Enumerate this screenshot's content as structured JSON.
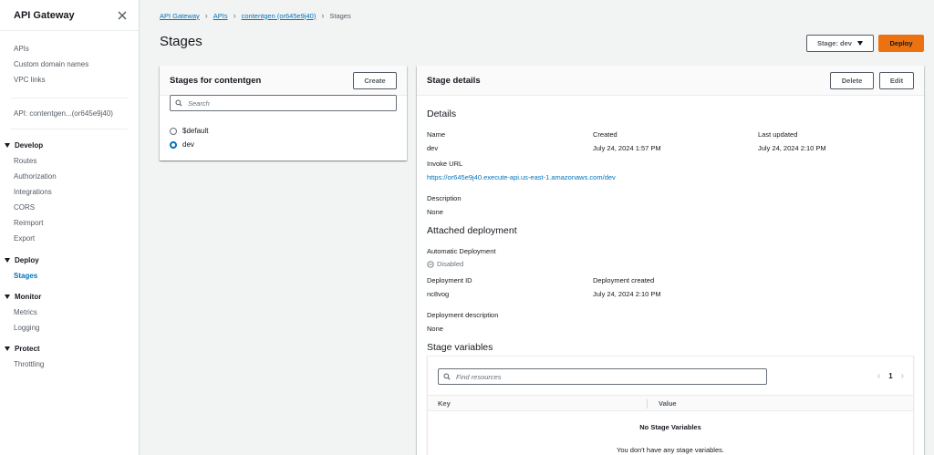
{
  "sidebar": {
    "title": "API Gateway",
    "links_top": [
      "APIs",
      "Custom domain names",
      "VPC links"
    ],
    "api_link": "API: contentgen...(or645e9j40)",
    "sections": {
      "develop": {
        "label": "Develop",
        "items": [
          "Routes",
          "Authorization",
          "Integrations",
          "CORS",
          "Reimport",
          "Export"
        ]
      },
      "deploy": {
        "label": "Deploy",
        "items": [
          "Stages"
        ]
      },
      "monitor": {
        "label": "Monitor",
        "items": [
          "Metrics",
          "Logging"
        ]
      },
      "protect": {
        "label": "Protect",
        "items": [
          "Throttling"
        ]
      }
    }
  },
  "breadcrumb": {
    "items": [
      "API Gateway",
      "APIs",
      "contentgen (or645e9j40)"
    ],
    "current": "Stages"
  },
  "page": {
    "title": "Stages"
  },
  "header_actions": {
    "stage_select": "Stage: dev",
    "deploy": "Deploy"
  },
  "stages_panel": {
    "title": "Stages for contentgen",
    "create": "Create",
    "search_placeholder": "Search",
    "stages": [
      "$default",
      "dev"
    ],
    "selected": "dev"
  },
  "details": {
    "title": "Stage details",
    "delete": "Delete",
    "edit": "Edit",
    "details_heading": "Details",
    "name_label": "Name",
    "name_value": "dev",
    "created_label": "Created",
    "created_value": "July 24, 2024 1:57 PM",
    "updated_label": "Last updated",
    "updated_value": "July 24, 2024 2:10 PM",
    "invoke_label": "Invoke URL",
    "invoke_value": "https://or645e9j40.execute-api.us-east-1.amazonaws.com/dev",
    "description_label": "Description",
    "description_value": "None",
    "attached_heading": "Attached deployment",
    "auto_label": "Automatic Deployment",
    "auto_value": "Disabled",
    "deployment_id_label": "Deployment ID",
    "deployment_id_value": "nc8vog",
    "deployment_created_label": "Deployment created",
    "deployment_created_value": "July 24, 2024 2:10 PM",
    "deployment_desc_label": "Deployment description",
    "deployment_desc_value": "None",
    "vars_heading": "Stage variables",
    "find_placeholder": "Find resources",
    "page_number": "1",
    "col_key": "Key",
    "col_value": "Value",
    "empty_title": "No Stage Variables",
    "empty_sub": "You don't have any stage variables."
  }
}
